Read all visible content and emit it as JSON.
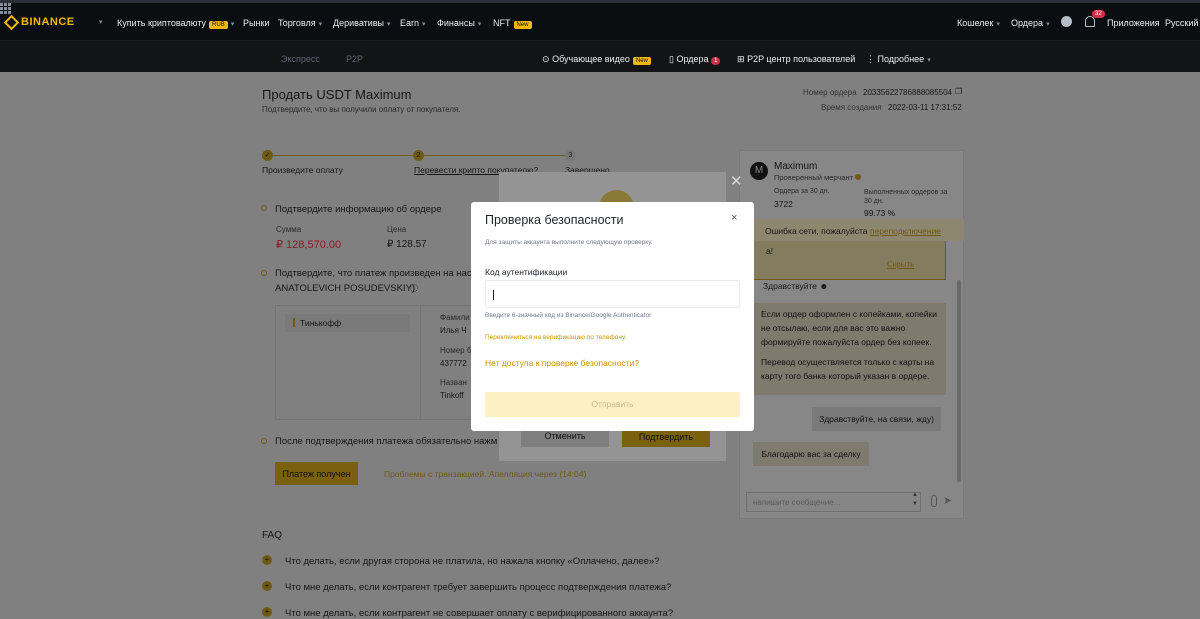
{
  "nav": {
    "logo": "BINANCE",
    "items": [
      {
        "label": "Купить криптовалюту",
        "badge": "RUB",
        "caret": true
      },
      {
        "label": "Рынки"
      },
      {
        "label": "Торговля",
        "caret": true
      },
      {
        "label": "Деривативы",
        "caret": true
      },
      {
        "label": "Earn",
        "caret": true
      },
      {
        "label": "Финансы",
        "caret": true
      },
      {
        "label": "NFT",
        "badge": "New"
      }
    ],
    "right": {
      "wallet": "Кошелек",
      "orders": "Ордера",
      "notif_count": "32",
      "apps": "Приложения",
      "lang": "Русский"
    }
  },
  "subnav": {
    "express": "Экспресс",
    "p2p": "P2P",
    "video": "Обучающее видео",
    "video_badge": "New",
    "orders": "Ордера",
    "orders_count": "1",
    "center": "P2P центр пользователей",
    "more": "Подробнее"
  },
  "order": {
    "title": "Продать USDT Maximum",
    "subtitle": "Подтвердите, что вы получили оплату от покупателя.",
    "number_label": "Номер ордера",
    "number": "20335622786888085504",
    "time_label": "Время создания",
    "time": "2022-03-11 17:31:52"
  },
  "steps": [
    {
      "num": "",
      "label": "Произведите оплату"
    },
    {
      "num": "2",
      "label": "Перевести крипто покупателю?"
    },
    {
      "num": "3",
      "label": "Завершено"
    }
  ],
  "confirm": {
    "heading": "Подтвердите информацию об ордере",
    "sum_label": "Сумма",
    "sum": "₽ 128,570.00",
    "price_label": "Цена",
    "price": "₽ 128.57",
    "payment_line1": "Подтвердите, что платеж произведен на нас",
    "payment_line2": "ANATOLEVICH POSUDEVSKIY).",
    "bank": "Тинькофф",
    "f1_label": "Фамили",
    "f1_value": "Илья Ч",
    "f2_label": "Номер б",
    "f2_value": "437772",
    "f3_label": "Назван",
    "f3_value": "Tinkoff",
    "after": "После подтверждения платежа обязательно нажм",
    "received_btn": "Платеж получен",
    "problems": "Проблемы с транзакцией. Апелляция через (14:04)"
  },
  "faq": {
    "title": "FAQ",
    "items": [
      "Что делать, если другая сторона не платила, но нажала кнопку «Оплачено, далее»?",
      "Что мне делать, если контрагент требует завершить процесс подтверждения платежа?",
      "Что мне делать, если контрагент не совершает оплату с верифицированного аккаунта?"
    ]
  },
  "bgdialog": {
    "cancel": "Отменить",
    "confirm": "Подтвердить"
  },
  "modal": {
    "title": "Проверка безопасности",
    "desc": "Для защиты аккаунта выполните следующую проверку.",
    "field_label": "Код аутентификации",
    "input_value": "",
    "hint": "Введите 6-значный код из Binance/Google Authenticator",
    "switch": "Переключиться на верификацию по телефону.",
    "no_access": "Нет доступа к проверке безопасности?",
    "submit": "Отправить"
  },
  "chat": {
    "avatar": "M",
    "name": "Maximum",
    "verified": "Проверенный мерчант",
    "orders30_label": "Ордера за 30 дн.",
    "orders30": "3722",
    "completed_label": "Выполненных ордеров за 30 дн.",
    "completed": "99.73 %",
    "network_error": "Ошибка сети, пожалуйста",
    "reconnect": "переподключение",
    "snippet": "а!",
    "hide": "Скрыть",
    "greet": "Здравствуйте",
    "msg1": "Если ордер оформлен с копейками, копейки не отсылаю, если для вас это важно формируйте пожалуйста ордер без копеек.",
    "msg2": "Перевод осуществляется только с карты на карту того банка который указан в ордере.",
    "reply": "Здравствуйте, на связи, жду)",
    "thanks": "Благодарю вас за сделку",
    "placeholder": "напишите сообщение..."
  }
}
